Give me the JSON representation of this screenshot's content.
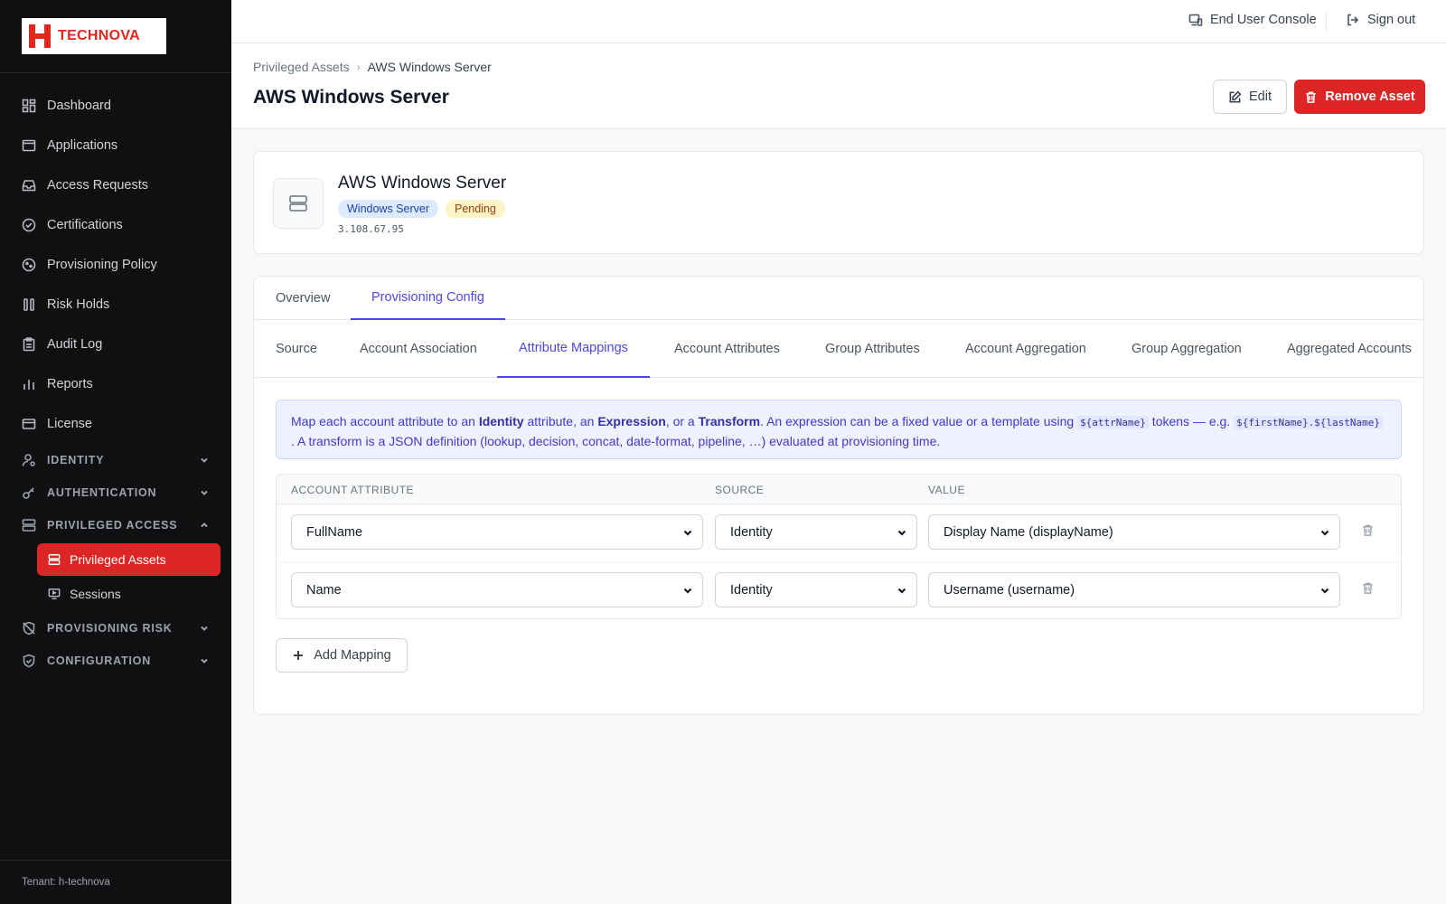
{
  "brand": {
    "name": "TECHNOVA",
    "accent": "#e1261c"
  },
  "sidebar": {
    "items": [
      {
        "label": "Dashboard",
        "icon": "dashboard-icon"
      },
      {
        "label": "Applications",
        "icon": "applications-icon"
      },
      {
        "label": "Access Requests",
        "icon": "inbox-icon"
      },
      {
        "label": "Certifications",
        "icon": "check-circle-icon"
      },
      {
        "label": "Provisioning Policy",
        "icon": "policy-icon"
      },
      {
        "label": "Risk Holds",
        "icon": "pause-icon"
      },
      {
        "label": "Audit Log",
        "icon": "clipboard-icon"
      },
      {
        "label": "Reports",
        "icon": "bar-chart-icon"
      },
      {
        "label": "License",
        "icon": "card-icon"
      }
    ],
    "sections": [
      {
        "label": "IDENTITY",
        "icon": "user-icon",
        "expanded": false
      },
      {
        "label": "AUTHENTICATION",
        "icon": "key-icon",
        "expanded": false
      },
      {
        "label": "PRIVILEGED ACCESS",
        "icon": "server-icon",
        "expanded": true
      },
      {
        "label": "PROVISIONING RISK",
        "icon": "shield-off-icon",
        "expanded": false
      },
      {
        "label": "CONFIGURATION",
        "icon": "shield-check-icon",
        "expanded": false
      }
    ],
    "sub_items": [
      {
        "label": "Privileged Assets",
        "active": true
      },
      {
        "label": "Sessions",
        "active": false
      }
    ],
    "tenant": "Tenant: h-technova"
  },
  "topbar": {
    "end_user_console": "End User Console",
    "sign_out": "Sign out"
  },
  "header": {
    "breadcrumb_parent": "Privileged Assets",
    "breadcrumb_current": "AWS Windows Server",
    "title": "AWS Windows Server",
    "edit_label": "Edit",
    "remove_label": "Remove Asset"
  },
  "asset": {
    "name": "AWS Windows Server",
    "type_badge": "Windows Server",
    "status_badge": "Pending",
    "ip": "3.108.67.95"
  },
  "tabs": [
    "Overview",
    "Provisioning Config"
  ],
  "active_tab": "Provisioning Config",
  "subtabs": [
    "Source",
    "Account Association",
    "Attribute Mappings",
    "Account Attributes",
    "Group Attributes",
    "Account Aggregation",
    "Group Aggregation",
    "Aggregated Accounts"
  ],
  "active_subtab": "Attribute Mappings",
  "info": {
    "t1": "Map each account attribute to an ",
    "b1": "Identity",
    "t2": " attribute, an ",
    "b2": "Expression",
    "t3": ", or a ",
    "b3": "Transform",
    "t4": ". An expression can be a fixed value or a template using ",
    "c1": "${attrName}",
    "t5": " tokens — e.g. ",
    "c2": "${firstName}.${lastName}",
    "t6": " . A transform is a JSON definition (lookup, decision, concat, date-format, pipeline, …) evaluated at provisioning time."
  },
  "mapping_table": {
    "headers": [
      "ACCOUNT ATTRIBUTE",
      "SOURCE",
      "VALUE"
    ],
    "rows": [
      {
        "attribute": "FullName",
        "source": "Identity",
        "value": "Display Name (displayName)"
      },
      {
        "attribute": "Name",
        "source": "Identity",
        "value": "Username (username)"
      }
    ]
  },
  "add_mapping_label": "Add Mapping"
}
